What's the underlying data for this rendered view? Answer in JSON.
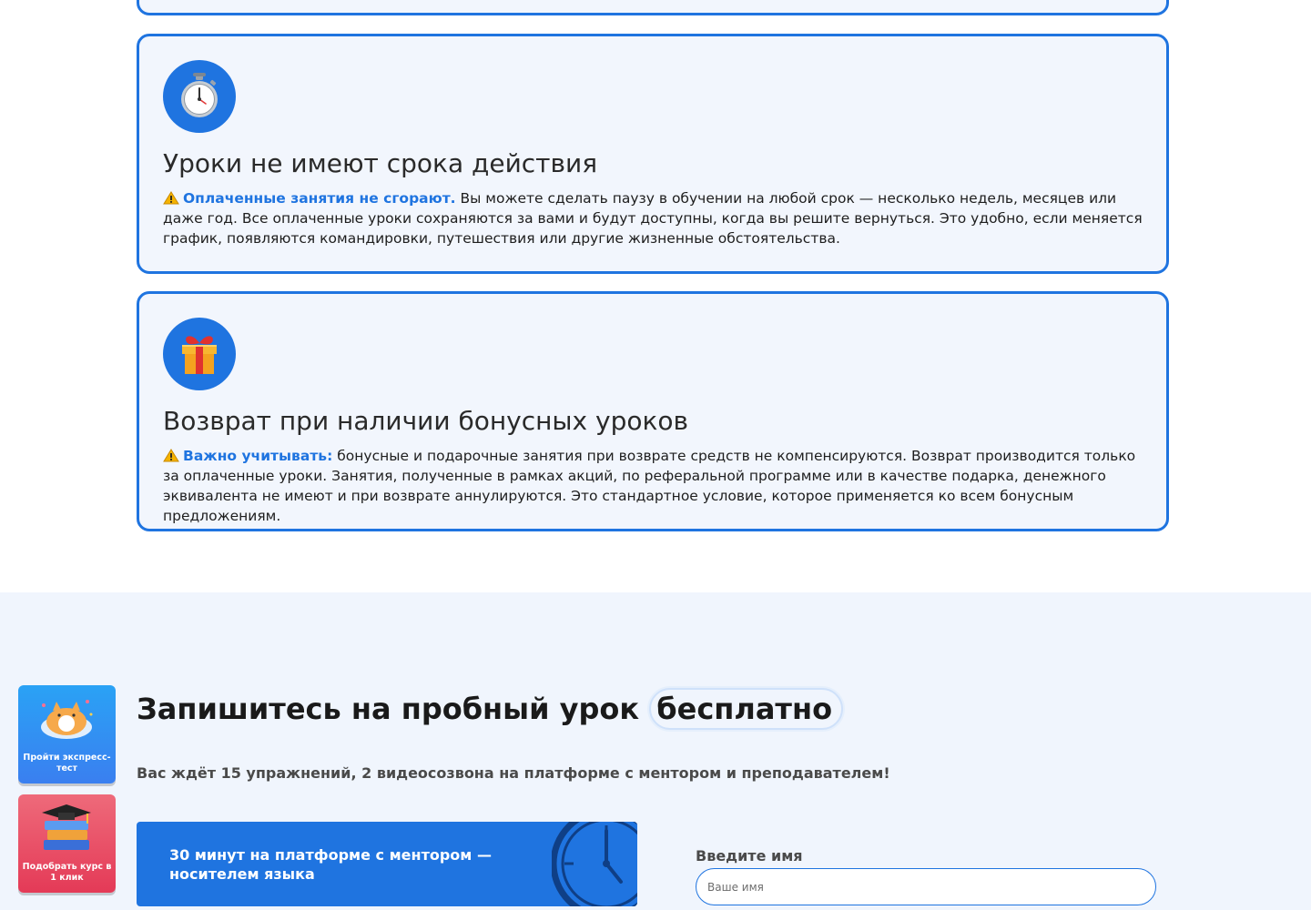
{
  "cards": [
    {
      "icon": "stopwatch-icon",
      "title": "Уроки не имеют срока действия",
      "highlight": "Оплаченные занятия не сгорают.",
      "text": " Вы можете сделать паузу в обучении на любой срок — несколько недель, месяцев или даже год. Все оплаченные уроки сохраняются за вами и будут доступны, когда вы решите вернуться. Это удобно, если меняется график, появляются командировки, путешествия или другие жизненные обстоятельства."
    },
    {
      "icon": "gift-icon",
      "title": "Возврат при наличии бонусных уроков",
      "highlight": "Важно учитывать:",
      "text": " бонусные и подарочные занятия при возврате средств не компенсируются. Возврат производится только за оплаченные уроки. Занятия, полученные в рамках акций, по реферальной программе или в качестве подарка, денежного эквивалента не имеют и при возврате аннулируются. Это стандартное условие, которое применяется ко всем бонусным предложениям."
    }
  ],
  "side_tiles": {
    "test_label": "Пройти экспресс-тест",
    "course_label": "Подобрать курс в 1 клик"
  },
  "signup": {
    "title": "Запишитесь на пробный урок",
    "title_accent": "бесплатно",
    "subtitle": "Вас ждёт 15 упражнений, 2 видеосозвона на платформе с ментором и преподавателем!",
    "promo_text": "30 минут на платформе с ментором — носителем языка",
    "name_label": "Введите имя",
    "name_placeholder": "Ваше имя",
    "name_value": ""
  },
  "colors": {
    "accent": "#1f74e0",
    "card_bg": "#f2f6fd",
    "section_bg": "#f0f5fd",
    "tile_test": "#3a7ff0",
    "tile_course": "#e43a57"
  }
}
